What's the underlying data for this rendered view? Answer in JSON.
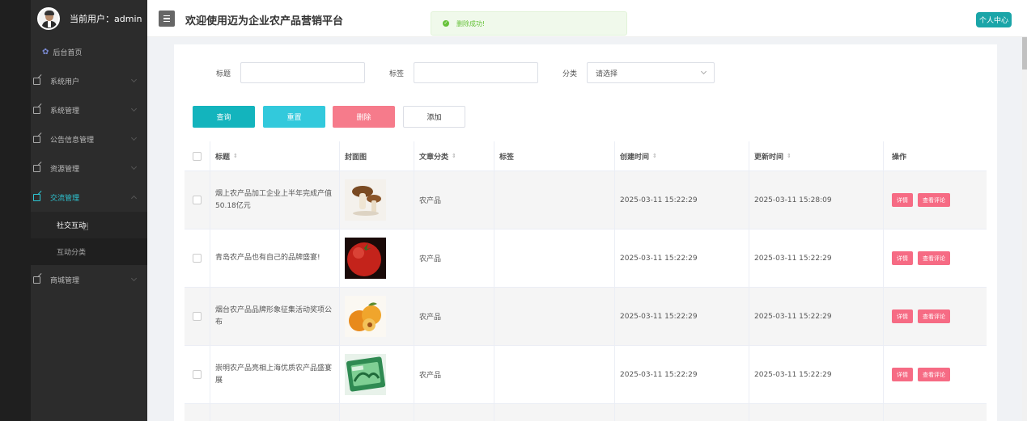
{
  "user": {
    "label": "当前用户：",
    "name": "admin"
  },
  "sidebar": {
    "home": "后台首页",
    "items": [
      {
        "label": "系统用户"
      },
      {
        "label": "系统管理"
      },
      {
        "label": "公告信息管理"
      },
      {
        "label": "资源管理"
      },
      {
        "label": "交流管理"
      },
      {
        "label": "商城管理"
      }
    ],
    "submenu": [
      "社交互动",
      "互动分类"
    ]
  },
  "header": {
    "title": "欢迎使用迈为企业农产品营销平台",
    "personal_center": "个人中心"
  },
  "toast": {
    "message": "删除成功!"
  },
  "filters": {
    "title_label": "标题",
    "tag_label": "标签",
    "category_label": "分类",
    "category_placeholder": "请选择"
  },
  "buttons": {
    "query": "查询",
    "reset": "重置",
    "delete": "删除",
    "add": "添加"
  },
  "table": {
    "headers": [
      "标题",
      "封面图",
      "文章分类",
      "标签",
      "创建时间",
      "更新时间",
      "操作"
    ],
    "rows": [
      {
        "title": "烟上农产品加工企业上半年完成产值50.18亿元",
        "image": "mushroom",
        "category": "农产品",
        "tag": "",
        "created": "2025-03-11 15:22:29",
        "updated": "2025-03-11 15:28:09"
      },
      {
        "title": "青岛农产品也有自己的品牌盛宴!",
        "image": "tomato",
        "category": "农产品",
        "tag": "",
        "created": "2025-03-11 15:22:29",
        "updated": "2025-03-11 15:22:29"
      },
      {
        "title": "烟台农产品品牌形象征集活动奖项公布",
        "image": "apricot",
        "category": "农产品",
        "tag": "",
        "created": "2025-03-11 15:22:29",
        "updated": "2025-03-11 15:22:29"
      },
      {
        "title": "崇明农产品亮相上海优质农产品盛宴展",
        "image": "greens",
        "category": "农产品",
        "tag": "",
        "created": "2025-03-11 15:22:29",
        "updated": "2025-03-11 15:22:29"
      }
    ],
    "actions": {
      "detail": "详情",
      "comments": "查看评论"
    }
  }
}
